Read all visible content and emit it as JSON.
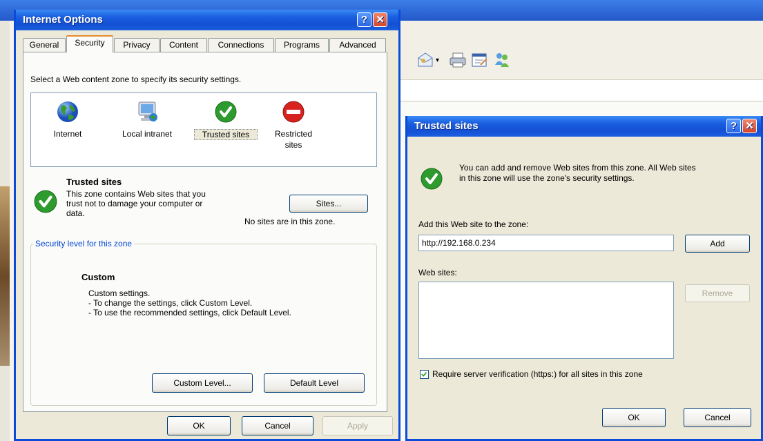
{
  "internet_options": {
    "title": "Internet Options",
    "help": "?",
    "close": "✕",
    "tabs": [
      "General",
      "Security",
      "Privacy",
      "Content",
      "Connections",
      "Programs",
      "Advanced"
    ],
    "active_tab": "Security",
    "zone_prompt": "Select a Web content zone to specify its security settings.",
    "zones": [
      {
        "label": "Internet",
        "icon": "globe-icon"
      },
      {
        "label": "Local intranet",
        "icon": "monitor-globe-icon"
      },
      {
        "label": "Trusted sites",
        "icon": "green-check-icon"
      },
      {
        "label_line1": "Restricted",
        "label_line2": "sites",
        "icon": "red-no-entry-icon"
      }
    ],
    "selected_zone_title": "Trusted sites",
    "zone_desc_line1": "This zone contains Web sites that you",
    "zone_desc_line2": "trust not to damage your computer or",
    "zone_desc_line3": "data.",
    "sites_button": "Sites...",
    "no_sites": "No sites are in this zone.",
    "security_level_legend": "Security level for this zone",
    "level_name": "Custom",
    "level_line1": "Custom settings.",
    "level_line2": "- To change the settings, click Custom Level.",
    "level_line3": "- To use the recommended settings, click Default Level.",
    "custom_level_button": "Custom Level...",
    "default_level_button": "Default Level",
    "ok": "OK",
    "cancel": "Cancel",
    "apply": "Apply"
  },
  "trusted_sites": {
    "title": "Trusted sites",
    "help": "?",
    "close": "✕",
    "info_line1": "You can add and remove Web sites from this zone. All Web sites",
    "info_line2": "in this zone will use the zone's security settings.",
    "add_label": "Add this Web site to the zone:",
    "add_value": "http://192.168.0.234",
    "add_button": "Add",
    "websites_label": "Web sites:",
    "remove_button": "Remove",
    "require_https_label": "Require server verification (https:) for all sites in this zone",
    "require_https_checked": true,
    "ok": "OK",
    "cancel": "Cancel"
  },
  "colors": {
    "title_blue": "#1a5fe0",
    "dialog_bg": "#ece9d8",
    "check_green": "#2e9b2e",
    "restricted_red": "#d8221e"
  }
}
